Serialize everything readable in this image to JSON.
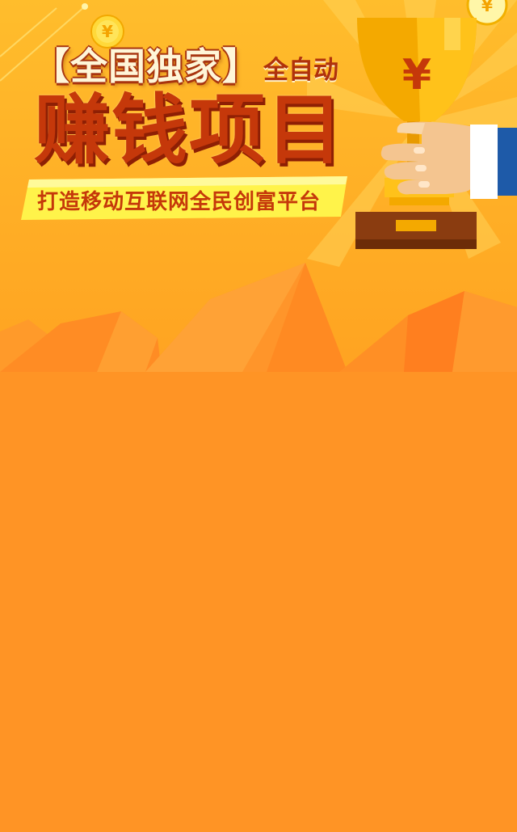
{
  "banner": {
    "bracket_open": "【",
    "exclusive_text": "全国独家",
    "bracket_close": "】",
    "auto_text": "全自动",
    "main_title": "赚钱项目",
    "tagline": "打造移动互联网全民创富平台",
    "currency_symbol": "¥",
    "colors": {
      "sky": "#ffb025",
      "mountains": "#ff8a22",
      "title_red": "#c5380a",
      "page_orange": "#ff9425"
    },
    "icons": [
      "yen-coin-icon",
      "trophy-icon",
      "hand-icon"
    ]
  }
}
